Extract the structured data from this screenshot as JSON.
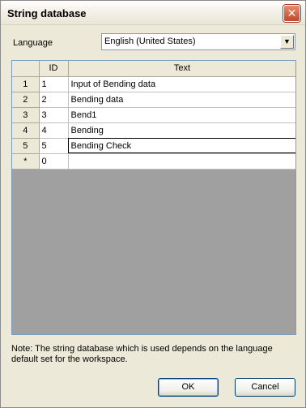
{
  "window": {
    "title": "String database",
    "close_glyph": "✕"
  },
  "language": {
    "label": "Language",
    "selected": "English (United States)",
    "dropdown_glyph": "▼"
  },
  "grid": {
    "columns": [
      "",
      "ID",
      "Text"
    ],
    "rows": [
      {
        "header": "1",
        "id": "1",
        "text": "Input of Bending data"
      },
      {
        "header": "2",
        "id": "2",
        "text": "Bending data"
      },
      {
        "header": "3",
        "id": "3",
        "text": "Bend1"
      },
      {
        "header": "4",
        "id": "4",
        "text": "Bending"
      },
      {
        "header": "5",
        "id": "5",
        "text": "Bending Check"
      },
      {
        "header": "*",
        "id": "0",
        "text": ""
      }
    ],
    "active_row": 4
  },
  "note": "Note: The string database which is used depends on the language default set for the workspace.",
  "buttons": {
    "ok": "OK",
    "cancel": "Cancel"
  },
  "icons": {
    "close": "close-icon",
    "dropdown": "chevron-down-icon"
  }
}
